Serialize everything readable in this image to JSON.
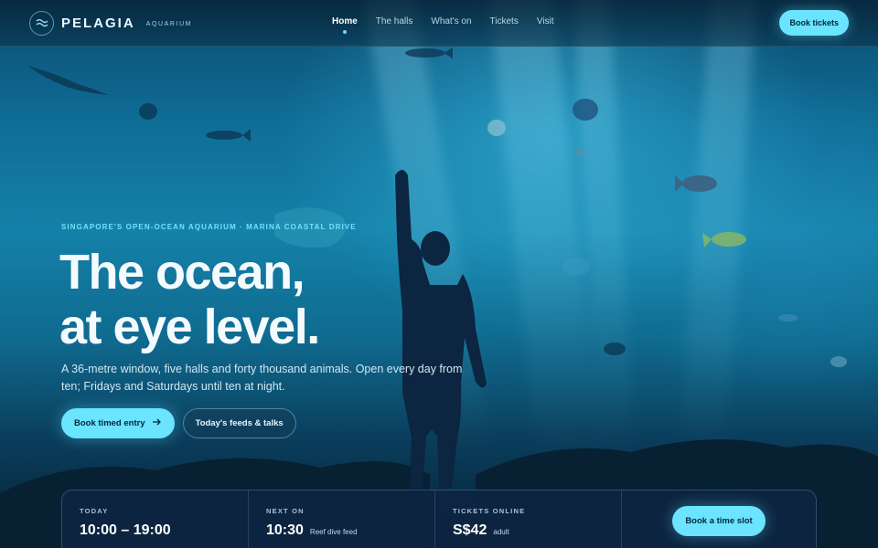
{
  "brand": {
    "name": "PELAGIA",
    "subtitle": "AQUARIUM"
  },
  "nav": {
    "links": [
      {
        "label": "Home",
        "active": true
      },
      {
        "label": "The halls",
        "active": false
      },
      {
        "label": "What's on",
        "active": false
      },
      {
        "label": "Tickets",
        "active": false
      },
      {
        "label": "Visit",
        "active": false
      }
    ],
    "cta": "Book tickets"
  },
  "hero": {
    "eyebrow": "SINGAPORE'S OPEN-OCEAN AQUARIUM · MARINA COASTAL DRIVE",
    "headline": [
      "The ocean,",
      "at eye level."
    ],
    "lede": "A 36-metre window, five halls and forty thousand animals. Open every day from ten; Fridays and Saturdays until ten at night.",
    "primary_cta": "Book timed entry",
    "secondary_cta": "Today's feeds & talks"
  },
  "info": {
    "today": {
      "label": "TODAY",
      "value": "10:00 – 19:00"
    },
    "next_on": {
      "label": "NEXT ON",
      "time": "10:30",
      "event": "Reef dive feed"
    },
    "tickets": {
      "label": "TICKETS ONLINE",
      "price": "S$42",
      "unit": "adult"
    },
    "cta": "Book a time slot"
  },
  "colors": {
    "accent": "#6ae4ff",
    "deep": "#06263a",
    "panel": "#0e2442"
  },
  "icons": {
    "brand": "waves-icon",
    "arrow": "arrow-right-icon"
  }
}
